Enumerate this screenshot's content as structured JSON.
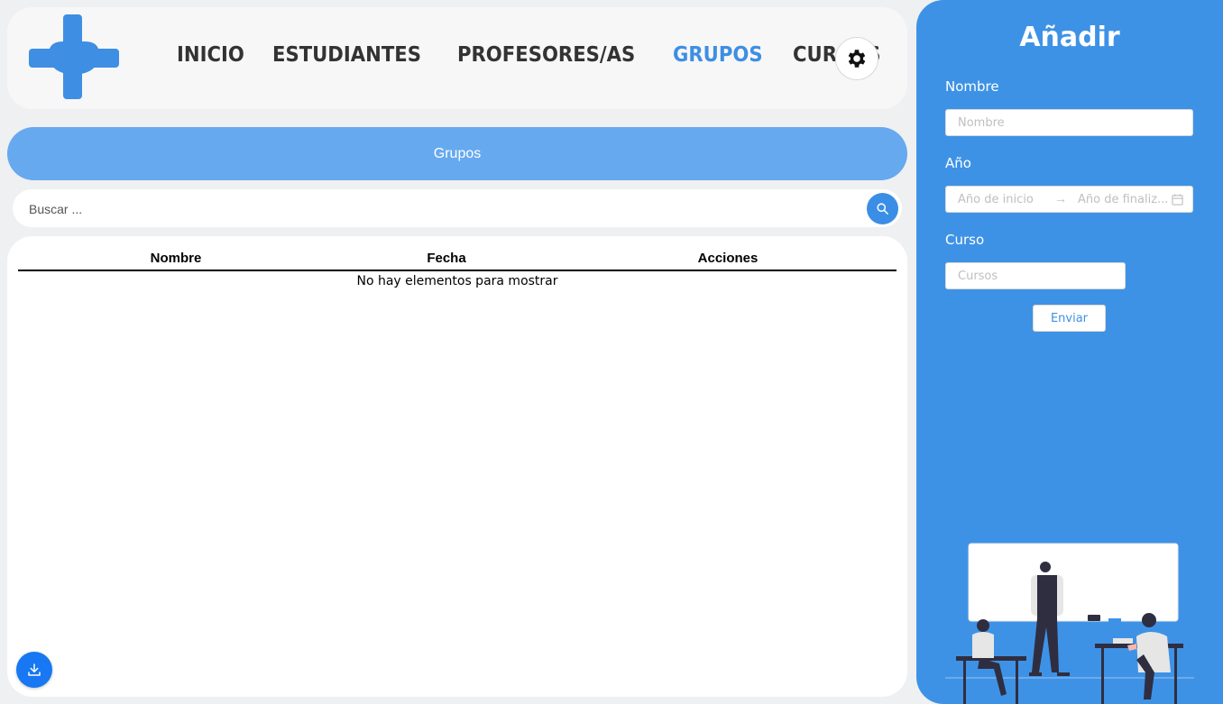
{
  "header": {
    "nav": [
      {
        "label": "INICIO",
        "active": false
      },
      {
        "label": "ESTUDIANTES",
        "active": false
      },
      {
        "label": "PROFESORES/AS",
        "active": false
      },
      {
        "label": "GRUPOS",
        "active": true
      },
      {
        "label": "CURSOS",
        "active": false
      }
    ],
    "settings_icon": "gear-icon",
    "logo_icon": "cross-logo-icon"
  },
  "page": {
    "title": "Grupos"
  },
  "search": {
    "placeholder": "Buscar ...",
    "value": "",
    "icon": "search-icon"
  },
  "table": {
    "columns": [
      "Nombre",
      "Fecha",
      "Acciones"
    ],
    "rows": [],
    "empty_message": "No hay elementos para mostrar"
  },
  "download": {
    "icon": "download-icon"
  },
  "form": {
    "title": "Añadir",
    "nombre_label": "Nombre",
    "nombre_placeholder": "Nombre",
    "ano_label": "Año",
    "ano_start_placeholder": "Año de inicio",
    "ano_end_placeholder": "Año de finaliz...",
    "curso_label": "Curso",
    "curso_placeholder": "Cursos",
    "submit_label": "Enviar"
  },
  "colors": {
    "accent": "#3e8ee4",
    "title_bar": "#66a9ef",
    "side_panel": "#3e92e6",
    "download_button": "#1877f2"
  }
}
